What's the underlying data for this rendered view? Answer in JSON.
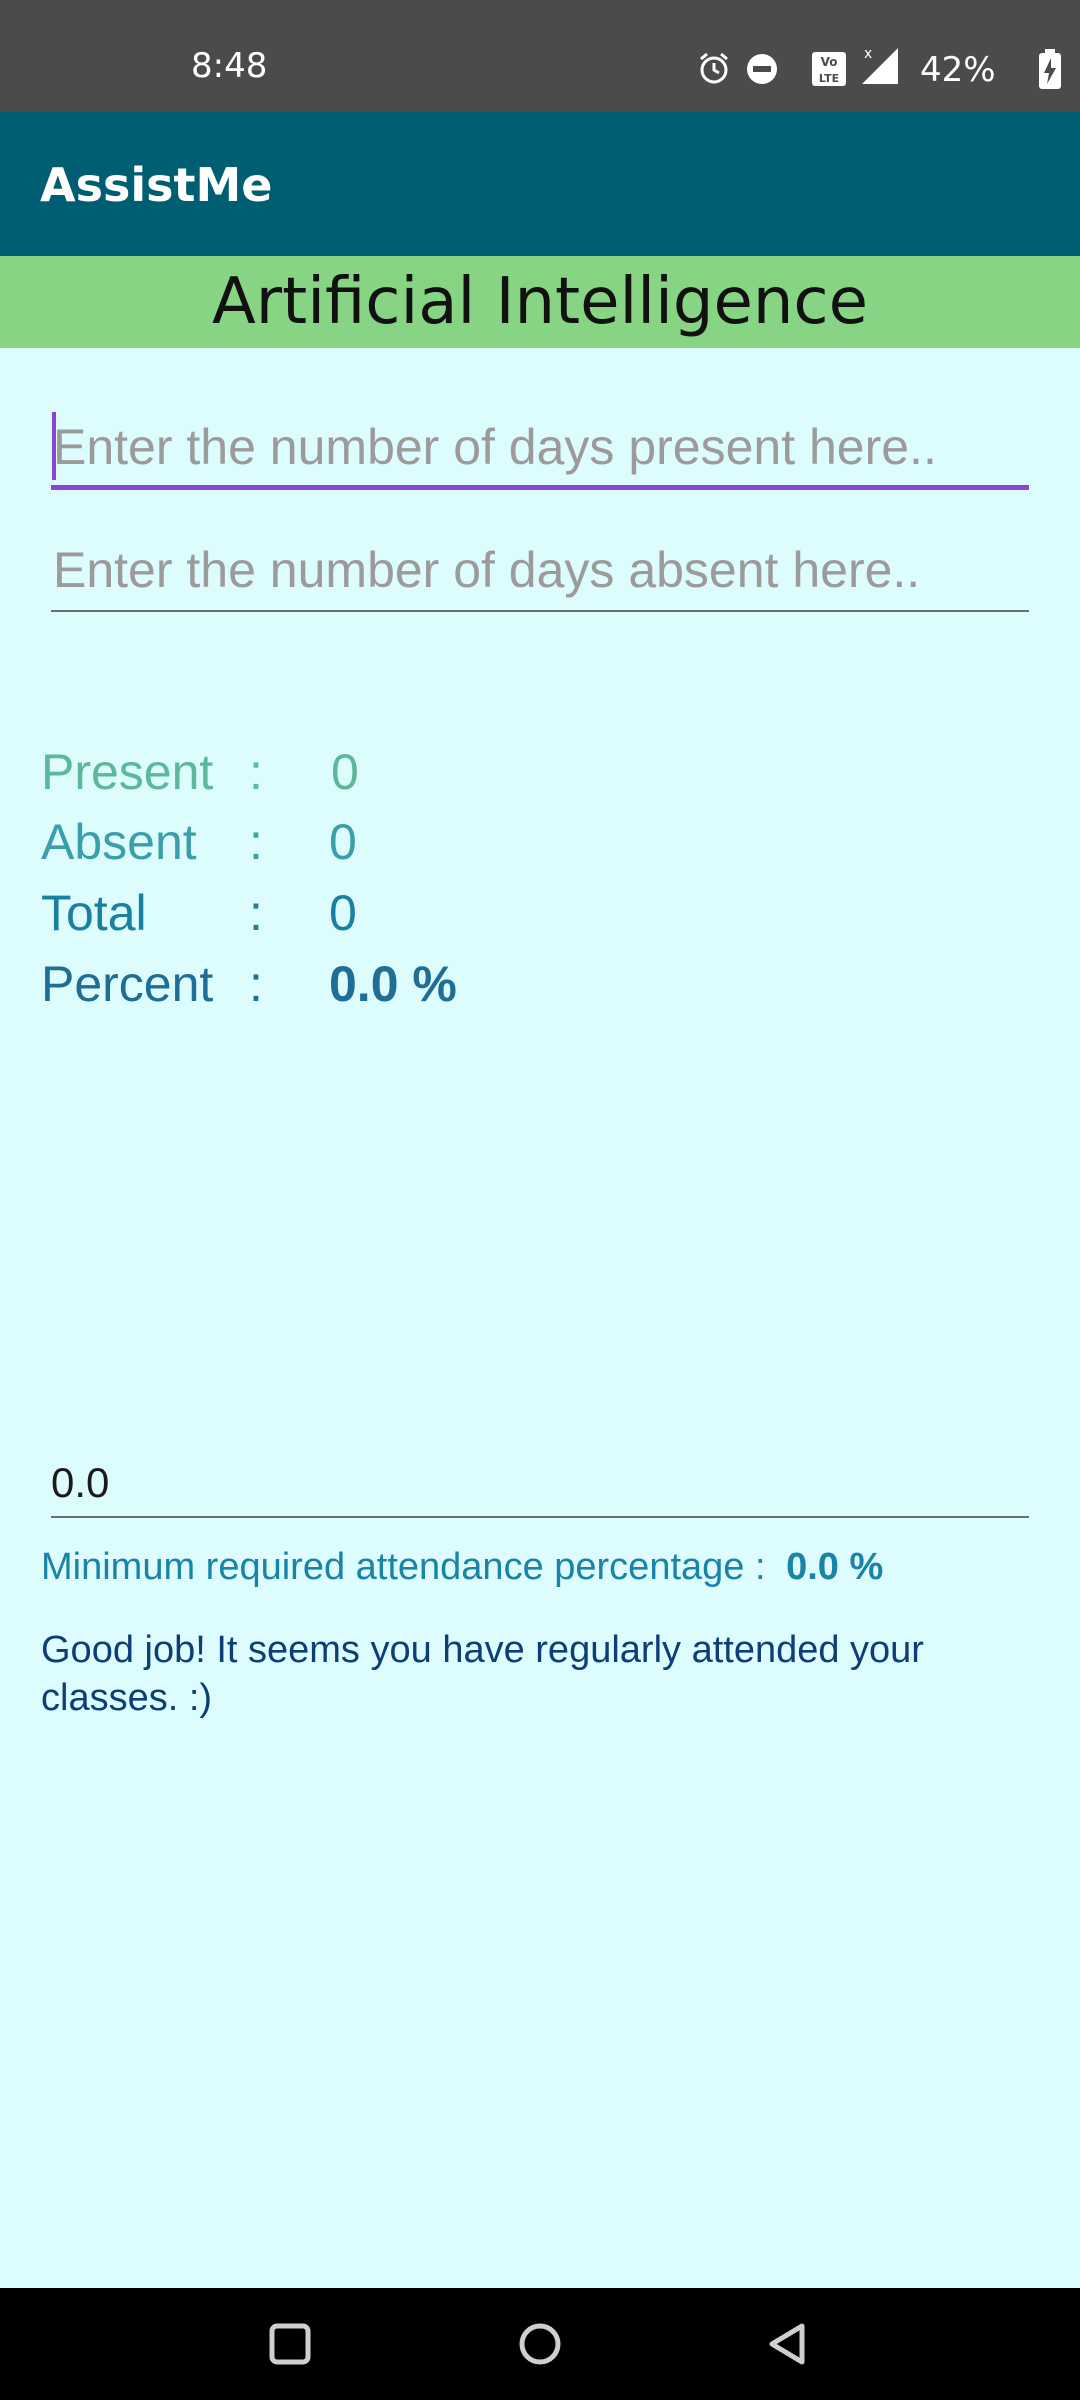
{
  "status_bar": {
    "time": "8:48",
    "battery_percent": "42%",
    "icons": [
      "alarm-icon",
      "do-not-disturb-icon",
      "volte-icon",
      "signal-icon",
      "battery-charging-icon"
    ]
  },
  "app_bar": {
    "title": "AssistMe",
    "color": "#005E73"
  },
  "subject": {
    "name": "Artificial Intelligence",
    "color": "#87D485"
  },
  "inputs": {
    "present": {
      "value": "",
      "placeholder": "Enter the number of days present here.."
    },
    "absent": {
      "value": "",
      "placeholder": "Enter the number of days absent here.."
    }
  },
  "stats": {
    "present": {
      "label": "Present",
      "colon": ":",
      "value": "0"
    },
    "absent": {
      "label": "Absent",
      "colon": ":",
      "value": "0"
    },
    "total": {
      "label": "Total",
      "colon": ":",
      "value": "0"
    },
    "percent": {
      "label": "Percent",
      "colon": ":",
      "value": "0.0 %"
    }
  },
  "minimum": {
    "input_value": "0.0",
    "label": "Minimum required attendance percentage :",
    "value": "0.0 %"
  },
  "message": "Good job! It seems you have regularly attended your classes. :)",
  "nav_bar": {
    "buttons": [
      "recents-button",
      "home-button",
      "back-button"
    ]
  },
  "colors": {
    "background": "#DDFCFD",
    "accent": "#8A44D6"
  }
}
